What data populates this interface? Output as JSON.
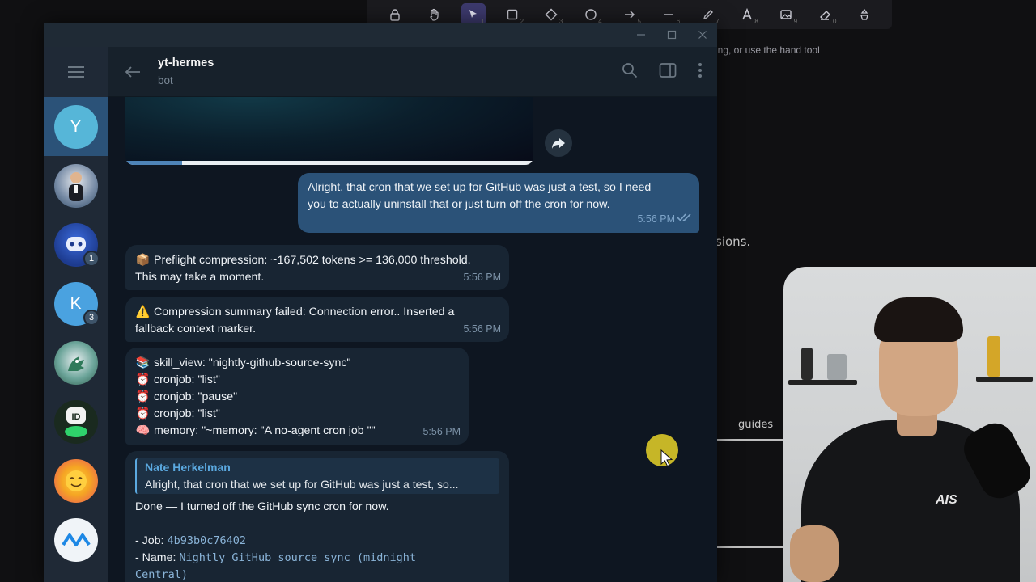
{
  "draw_tools": [
    {
      "name": "lock-tool",
      "num": ""
    },
    {
      "name": "hand-tool",
      "num": ""
    },
    {
      "name": "selection-tool",
      "num": "1"
    },
    {
      "name": "rectangle-tool",
      "num": "2"
    },
    {
      "name": "diamond-tool",
      "num": "3"
    },
    {
      "name": "ellipse-tool",
      "num": "4"
    },
    {
      "name": "arrow-tool",
      "num": "5"
    },
    {
      "name": "line-tool",
      "num": "6"
    },
    {
      "name": "pencil-tool",
      "num": "7"
    },
    {
      "name": "text-tool",
      "num": "8"
    },
    {
      "name": "image-tool",
      "num": "9"
    },
    {
      "name": "eraser-tool",
      "num": "0"
    },
    {
      "name": "library-tool",
      "num": ""
    }
  ],
  "canvas": {
    "hint": "ing, or use the hand tool",
    "sketch_word_1": "sions.",
    "sketch_word_2": "guides"
  },
  "webcam": {
    "shirt_logo": "AIS"
  },
  "telegram": {
    "header": {
      "name": "yt-hermes",
      "status": "bot"
    },
    "sidebar_chats": [
      {
        "initial": "Y",
        "color": "#56b6d8",
        "badge": "",
        "selected": true
      },
      {
        "initial": "",
        "color": "#3a5a7a",
        "badge": "",
        "selected": false
      },
      {
        "initial": "",
        "color": "#1d3b8f",
        "badge": "1",
        "selected": false
      },
      {
        "initial": "K",
        "color": "#4aa2e0",
        "badge": "3",
        "selected": false
      },
      {
        "initial": "",
        "color": "#2d5a4a",
        "badge": "",
        "selected": false
      },
      {
        "initial": "",
        "color": "#1a2a1f",
        "badge": "",
        "selected": false
      },
      {
        "initial": "",
        "color": "#e8505b",
        "badge": "",
        "selected": false
      },
      {
        "initial": "",
        "color": "#f0f4f8",
        "badge": "",
        "selected": false
      }
    ],
    "messages": {
      "outgoing": {
        "text": "Alright, that cron that we set up for GitHub was just a test, so I need you to actually uninstall that or just turn off the cron for now.",
        "line1": "Alright, that cron that we set up for GitHub was just a test, so I need",
        "line2": "you to actually uninstall that or just turn off the cron for now.",
        "time": "5:56 PM"
      },
      "preflight": {
        "emoji": "📦",
        "line1": "Preflight compression: ~167,502 tokens >= 136,000 threshold.",
        "line2": "This may take a moment.",
        "time": "5:56 PM"
      },
      "compression": {
        "emoji": "⚠️",
        "line1": "Compression summary failed: Connection error.. Inserted a",
        "line2": "fallback context marker.",
        "time": "5:56 PM"
      },
      "tools": {
        "lines": [
          {
            "emoji": "📚",
            "text": "skill_view: \"nightly-github-source-sync\""
          },
          {
            "emoji": "⏰",
            "text": "cronjob: \"list\""
          },
          {
            "emoji": "⏰",
            "text": "cronjob: \"pause\""
          },
          {
            "emoji": "⏰",
            "text": "cronjob: \"list\""
          },
          {
            "emoji": "🧠",
            "text": "memory: \"~memory: \"A no-agent cron job \"\""
          }
        ],
        "time": "5:56 PM"
      },
      "reply": {
        "quote_author": "Nate Herkelman",
        "quote_text": "Alright, that cron that we set up for GitHub was just a test, so...",
        "body": "Done — I turned off the GitHub sync cron for now.",
        "job_label": "- Job: ",
        "job_value": "4b93b0c76402",
        "name_label": "- Name: ",
        "name_value_1": "Nightly GitHub source sync (midnight",
        "name_value_2": "Central)"
      }
    }
  }
}
